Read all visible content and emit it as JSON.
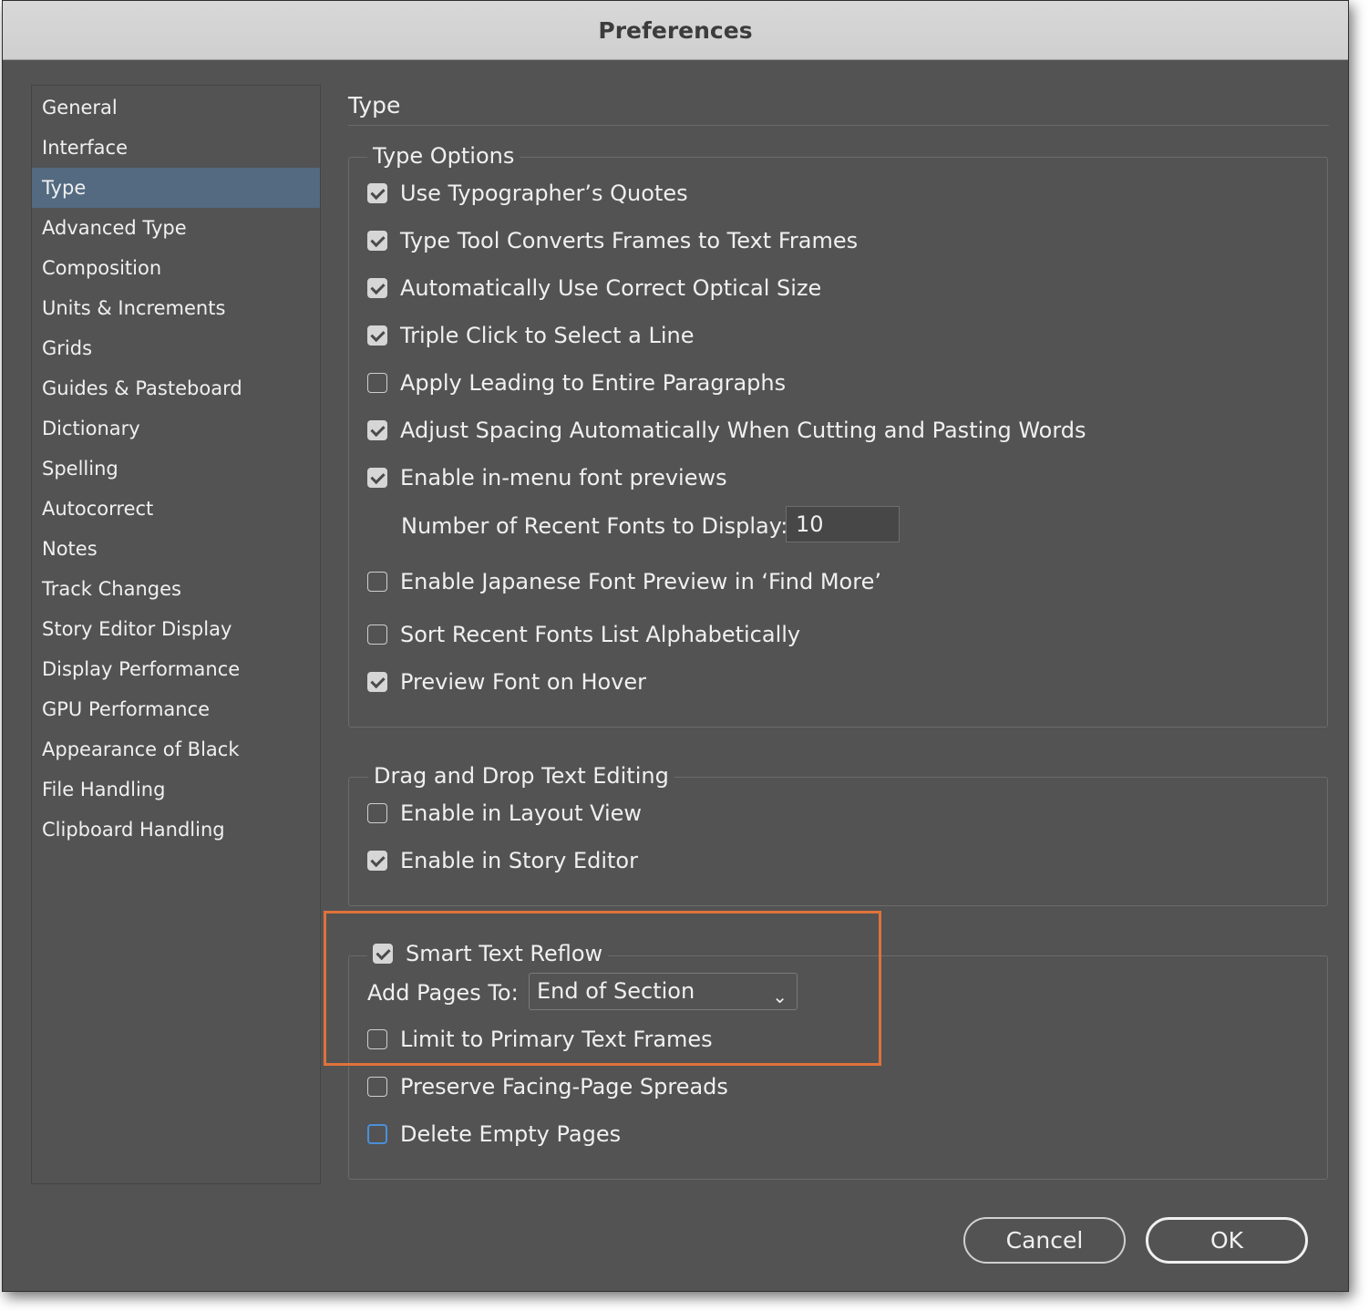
{
  "window": {
    "title": "Preferences"
  },
  "sidebar": {
    "items": [
      {
        "label": "General",
        "active": false
      },
      {
        "label": "Interface",
        "active": false
      },
      {
        "label": "Type",
        "active": true
      },
      {
        "label": "Advanced Type",
        "active": false
      },
      {
        "label": "Composition",
        "active": false
      },
      {
        "label": "Units & Increments",
        "active": false
      },
      {
        "label": "Grids",
        "active": false
      },
      {
        "label": "Guides & Pasteboard",
        "active": false
      },
      {
        "label": "Dictionary",
        "active": false
      },
      {
        "label": "Spelling",
        "active": false
      },
      {
        "label": "Autocorrect",
        "active": false
      },
      {
        "label": "Notes",
        "active": false
      },
      {
        "label": "Track Changes",
        "active": false
      },
      {
        "label": "Story Editor Display",
        "active": false
      },
      {
        "label": "Display Performance",
        "active": false
      },
      {
        "label": "GPU Performance",
        "active": false
      },
      {
        "label": "Appearance of Black",
        "active": false
      },
      {
        "label": "File Handling",
        "active": false
      },
      {
        "label": "Clipboard Handling",
        "active": false
      }
    ]
  },
  "main": {
    "title": "Type",
    "type_options": {
      "legend": "Type Options",
      "options": [
        {
          "label": "Use Typographer’s Quotes",
          "checked": true
        },
        {
          "label": "Type Tool Converts Frames to Text Frames",
          "checked": true
        },
        {
          "label": "Automatically Use Correct Optical Size",
          "checked": true
        },
        {
          "label": "Triple Click to Select a Line",
          "checked": true
        },
        {
          "label": "Apply Leading to Entire Paragraphs",
          "checked": false
        },
        {
          "label": "Adjust Spacing Automatically When Cutting and Pasting Words",
          "checked": true
        },
        {
          "label": "Enable in-menu font previews",
          "checked": true
        }
      ],
      "recent_fonts_label": "Number of Recent Fonts to Display:",
      "recent_fonts_value": "10",
      "options2": [
        {
          "label": "Enable Japanese Font Preview in ‘Find More’",
          "checked": false
        },
        {
          "label": "Sort Recent Fonts List Alphabetically",
          "checked": false
        },
        {
          "label": "Preview Font on Hover",
          "checked": true
        }
      ]
    },
    "drag_drop": {
      "legend": "Drag and Drop Text Editing",
      "options": [
        {
          "label": "Enable in Layout View",
          "checked": false
        },
        {
          "label": "Enable in Story Editor",
          "checked": true
        }
      ]
    },
    "smart_reflow": {
      "legend": "Smart Text Reflow",
      "checked": true,
      "add_pages_label": "Add Pages To:",
      "add_pages_value": "End of Section",
      "options": [
        {
          "label": "Limit to Primary Text Frames",
          "checked": false
        },
        {
          "label": "Preserve Facing-Page Spreads",
          "checked": false
        },
        {
          "label": "Delete Empty Pages",
          "checked": false,
          "focused": true
        }
      ]
    }
  },
  "buttons": {
    "cancel": "Cancel",
    "ok": "OK"
  },
  "colors": {
    "highlight": "#e0723a",
    "selection": "#536a80",
    "background": "#535353"
  }
}
